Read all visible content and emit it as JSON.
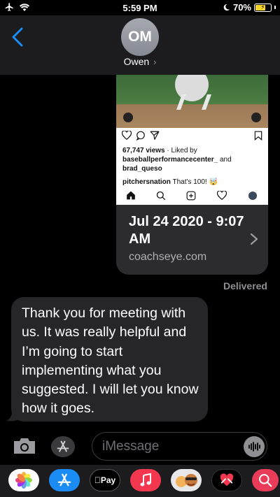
{
  "status_bar": {
    "time": "5:59 PM",
    "battery_percent": "70%",
    "battery_level": 0.7,
    "icons": [
      "airplane-icon",
      "wifi-icon",
      "moon-icon",
      "battery-charging-icon"
    ]
  },
  "header": {
    "avatar_initials": "OM",
    "contact_name": "Owen",
    "contact_chevron": "›"
  },
  "link_preview": {
    "instagram": {
      "views": "67,747 views",
      "liked_by_prefix": " · Liked by ",
      "liked_user_1": "baseballperformancecenter_",
      "liked_and": " and ",
      "liked_user_2": "brad_queso",
      "caption_user": "pitchersnation",
      "caption_text": " That's 100! 🤯"
    },
    "title": "Jul 24 2020 - 9:07 AM",
    "domain": "coachseye.com"
  },
  "delivered_label": "Delivered",
  "received_message": {
    "text": "Thank you for meeting with us. It was really helpful and I’m going to start implementing what you suggested. I will let you know how it goes."
  },
  "input": {
    "placeholder": "iMessage",
    "value": ""
  },
  "app_drawer": {
    "apps": [
      "photos-app",
      "app-store-app",
      "apple-pay-app",
      "music-app",
      "memoji-app",
      "digital-touch-app",
      "images-search-app"
    ],
    "apple_pay_label": "Pay",
    "apple_pay_logo": ""
  },
  "colors": {
    "accent_blue": "#1a8cf3",
    "bubble_received": "#262628",
    "bubble_link": "#2c2c2e",
    "header_bg": "#1c1c1e",
    "battery_charging": "#f5d328"
  }
}
